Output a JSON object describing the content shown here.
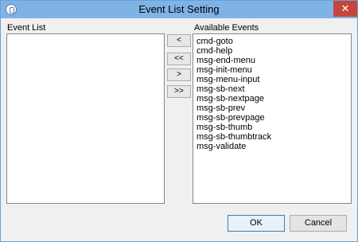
{
  "window": {
    "title": "Event List Setting",
    "close_glyph": "✕"
  },
  "left_panel": {
    "label": "Event List",
    "items": []
  },
  "right_panel": {
    "label": "Available Events",
    "items": [
      "cmd-goto",
      "cmd-help",
      "msg-end-menu",
      "msg-init-menu",
      "msg-menu-input",
      "msg-sb-next",
      "msg-sb-nextpage",
      "msg-sb-prev",
      "msg-sb-prevpage",
      "msg-sb-thumb",
      "msg-sb-thumbtrack",
      "msg-validate"
    ]
  },
  "move_buttons": {
    "add_one": "<",
    "add_all": "<<",
    "remove_one": ">",
    "remove_all": ">>"
  },
  "footer": {
    "ok_label": "OK",
    "cancel_label": "Cancel"
  },
  "colors": {
    "titlebar": "#7fb3e6",
    "close_button": "#c7463c",
    "dialog_background": "#f0f0f0"
  }
}
